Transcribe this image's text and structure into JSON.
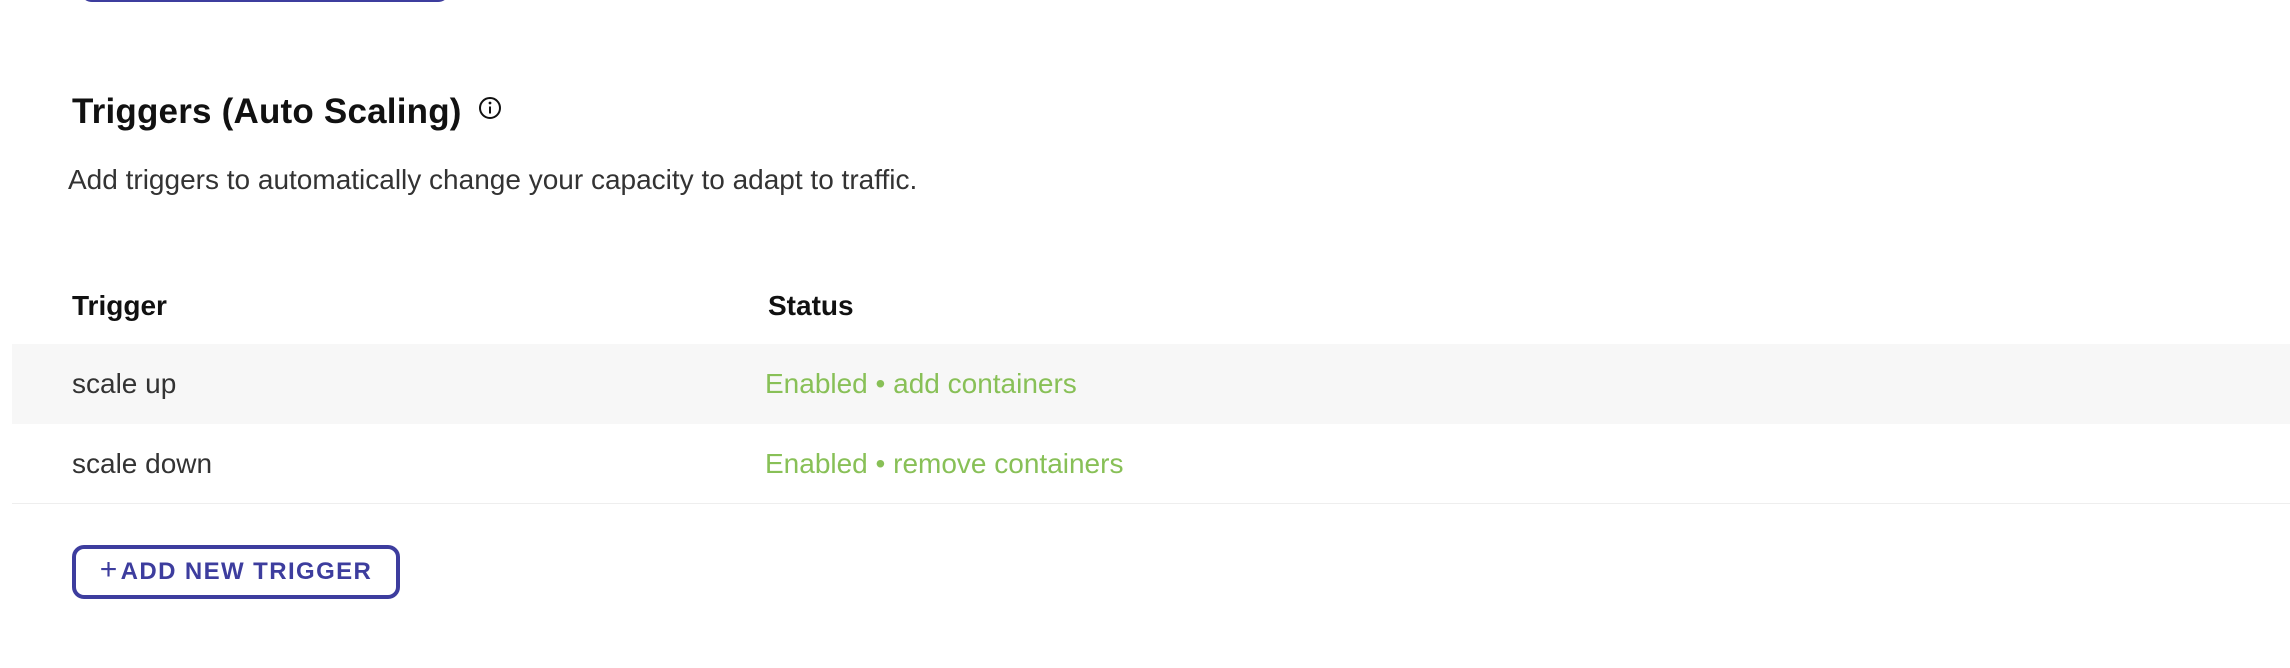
{
  "section": {
    "title": "Triggers (Auto Scaling)",
    "description": "Add triggers to automatically change your capacity to adapt to traffic.",
    "info_icon": "info-icon"
  },
  "table": {
    "columns": [
      "Trigger",
      "Status"
    ],
    "rows": [
      {
        "trigger": "scale up",
        "status": "Enabled • add containers"
      },
      {
        "trigger": "scale down",
        "status": "Enabled • remove containers"
      }
    ]
  },
  "actions": {
    "add_trigger_icon": "+",
    "add_trigger_label": "ADD NEW TRIGGER"
  },
  "colors": {
    "accent": "#3d3d9e",
    "status_enabled": "#88c057",
    "row_shade": "#f7f7f7"
  }
}
